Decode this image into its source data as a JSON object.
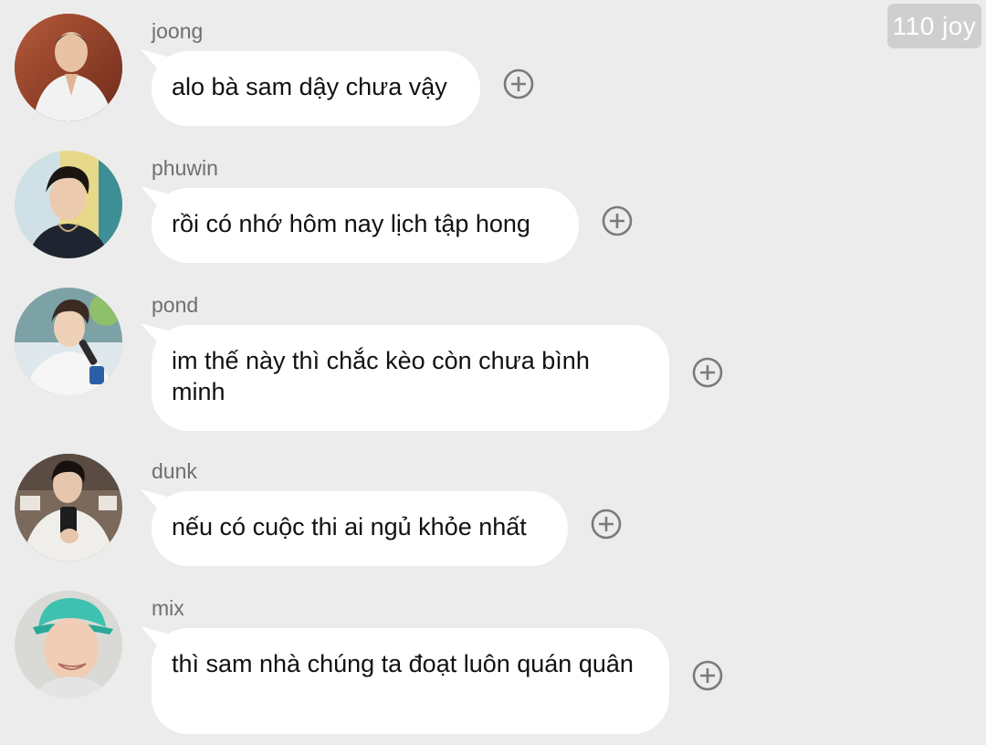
{
  "watermark": "110 joy",
  "messages": [
    {
      "sender": "joong",
      "text": "alo bà sam dậy chưa vậy",
      "avatar_icon": "profile-photo",
      "action_icon": "add-reaction-icon"
    },
    {
      "sender": "phuwin",
      "text": "rồi có nhớ hôm nay lịch tập hong",
      "avatar_icon": "profile-photo",
      "action_icon": "add-reaction-icon"
    },
    {
      "sender": "pond",
      "text": "im thế này thì chắc kèo còn chưa bình minh",
      "avatar_icon": "profile-photo",
      "action_icon": "add-reaction-icon"
    },
    {
      "sender": "dunk",
      "text": "nếu có cuộc thi ai ngủ khỏe nhất",
      "avatar_icon": "profile-photo",
      "action_icon": "add-reaction-icon"
    },
    {
      "sender": "mix",
      "text": "thì sam nhà chúng ta đoạt luôn quán quân",
      "avatar_icon": "profile-photo",
      "action_icon": "add-reaction-icon"
    }
  ],
  "colors": {
    "background": "#ececec",
    "bubble": "#ffffff",
    "sender_name": "#6f6f6f",
    "icon": "#7a7a7a",
    "watermark_bg": "#cfcfcf"
  }
}
